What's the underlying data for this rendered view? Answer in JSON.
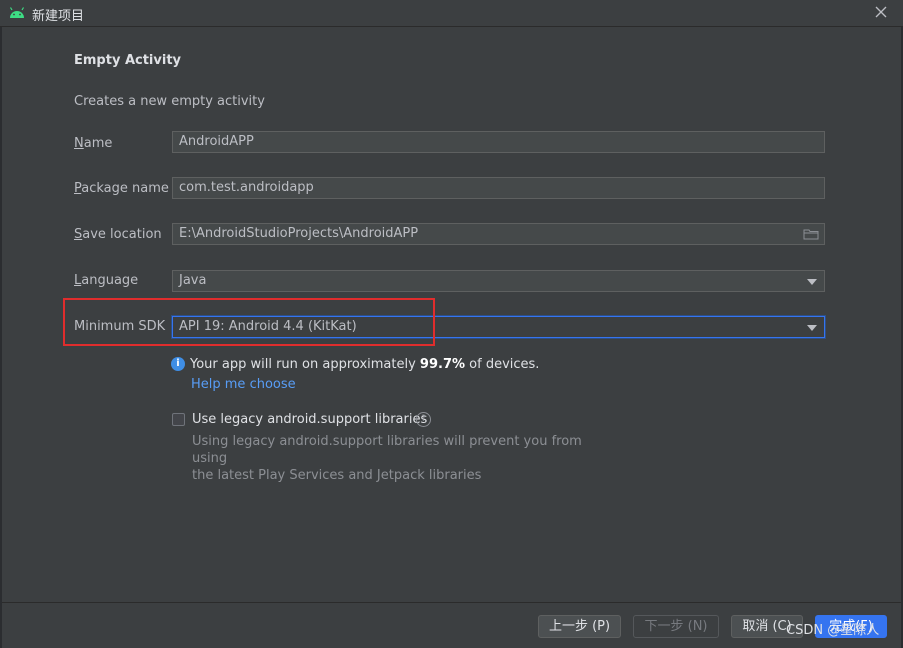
{
  "window": {
    "title": "新建项目",
    "icon": "android-icon",
    "close_icon": "close-icon"
  },
  "template": {
    "heading": "Empty Activity",
    "description": "Creates a new empty activity"
  },
  "form": {
    "name": {
      "label_first": "N",
      "label_rest": "ame",
      "value": "AndroidAPP"
    },
    "package_name": {
      "label_first": "P",
      "label_rest": "ackage name",
      "value": "com.test.androidapp"
    },
    "save_location": {
      "label_first": "S",
      "label_rest": "ave location",
      "value": "E:\\AndroidStudioProjects\\AndroidAPP"
    },
    "language": {
      "label_first": "L",
      "label_rest": "anguage",
      "value": "Java"
    },
    "minimum_sdk": {
      "label": "Minimum SDK",
      "value": "API 19: Android 4.4 (KitKat)"
    }
  },
  "info": {
    "prefix": "Your app will run on approximately ",
    "percent": "99.7%",
    "suffix": " of devices.",
    "help_link": "Help me choose"
  },
  "legacy": {
    "label": "Use legacy android.support libraries",
    "checked": false,
    "desc_line1": "Using legacy android.support libraries will prevent you from using",
    "desc_line2": "the latest Play Services and Jetpack libraries"
  },
  "footer": {
    "prev": "上一步 (P)",
    "next": "下一步 (N)",
    "cancel": "取消 (C)",
    "finish": "完成(F)"
  },
  "watermark": "CSDN @星際人",
  "colors": {
    "background": "#3c3f41",
    "accent": "#3574f0",
    "link": "#589df6",
    "highlight": "#e02d2d"
  }
}
